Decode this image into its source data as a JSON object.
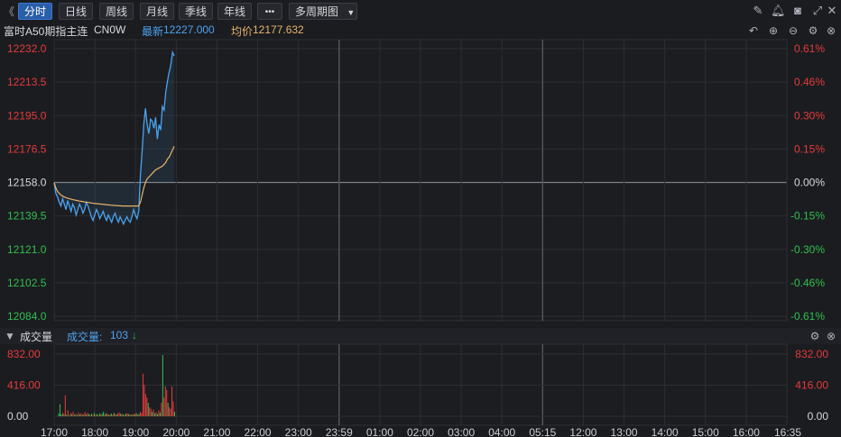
{
  "toolbar": {
    "nav_arrow": "《",
    "tabs": [
      "分时",
      "日线",
      "周线",
      "月线",
      "季线",
      "年线"
    ],
    "more": "•••",
    "multi_period": "多周期图",
    "multi_period_arrow": "▼"
  },
  "info": {
    "instrument": "富时A50期指主连",
    "code": "CN0W",
    "latest_label": "最新",
    "latest_value": "12227.000",
    "avg_label": "均价",
    "avg_value": "12177.632"
  },
  "volume_bar": {
    "label": "成交量",
    "metric_label": "成交量:",
    "metric_value": "103",
    "arrow": "↓"
  },
  "colors": {
    "price_line": "#4aa3f0",
    "avg_line": "#e8b36a",
    "up": "#e33b3b",
    "down": "#2fbf4f",
    "grid": "#2c2e33",
    "background": "#1b1c20"
  },
  "chart_data": [
    {
      "type": "line",
      "title": "",
      "yticks_left": [
        "12232.0",
        "12213.5",
        "12195.0",
        "12176.5",
        "12158.0",
        "12139.5",
        "12121.0",
        "12102.5",
        "12084.0"
      ],
      "yticks_right": [
        "0.61%",
        "0.46%",
        "0.30%",
        "0.15%",
        "0.00%",
        "-0.15%",
        "-0.30%",
        "-0.46%",
        "-0.61%"
      ],
      "ylim": [
        12084.0,
        12232.0
      ],
      "reference": 12158.0,
      "series": [
        {
          "values": [
            12158,
            12152,
            12150,
            12147,
            12145,
            12149,
            12146,
            12143,
            12148,
            12145,
            12142,
            12146,
            12144,
            12140,
            12143,
            12146,
            12144,
            12141,
            12143,
            12147,
            12145,
            12142,
            12139,
            12137,
            12140,
            12143,
            12141,
            12138,
            12140,
            12142,
            12139,
            12137,
            12140,
            12138,
            12136,
            12139,
            12141,
            12138,
            12136,
            12139,
            12137,
            12135,
            12137,
            12139,
            12137,
            12136,
            12139,
            12143,
            12140,
            12138,
            12142,
            12162,
            12175,
            12190,
            12199,
            12190,
            12185,
            12193,
            12192,
            12188,
            12194,
            12182,
            12190,
            12187,
            12200,
            12198,
            12208,
            12214,
            12219,
            12223,
            12230,
            12228
          ],
          "stroke": "#4aa3f0"
        },
        {
          "values": [
            12158,
            12155,
            12153,
            12152,
            12151,
            12150.5,
            12150,
            12149.6,
            12149.3,
            12149,
            12148.8,
            12148.5,
            12148.3,
            12148.1,
            12147.9,
            12147.7,
            12147.6,
            12147.4,
            12147.2,
            12147.1,
            12147,
            12146.8,
            12146.7,
            12146.5,
            12146.4,
            12146.3,
            12146.2,
            12146.1,
            12146,
            12145.9,
            12145.8,
            12145.7,
            12145.6,
            12145.5,
            12145.4,
            12145.3,
            12145.3,
            12145.2,
            12145.1,
            12145.1,
            12145,
            12145,
            12145,
            12145,
            12145,
            12145,
            12145,
            12145,
            12145,
            12145,
            12145,
            12147,
            12151,
            12155,
            12158,
            12160,
            12161,
            12162,
            12163,
            12164,
            12165,
            12165.5,
            12166,
            12166.5,
            12167,
            12168,
            12169,
            12171,
            12172,
            12174,
            12176,
            12178
          ],
          "stroke": "#e8b36a"
        }
      ],
      "x_ticks": [
        "17:00",
        "18:00",
        "19:00",
        "20:00",
        "21:00",
        "22:00",
        "23:00",
        "23:59",
        "01:00",
        "02:00",
        "03:00",
        "04:00",
        "05:15",
        "12:00",
        "13:00",
        "14:00",
        "15:00",
        "16:00",
        "16:35"
      ]
    },
    {
      "type": "bar",
      "title": "",
      "yticks_left": [
        "832.00",
        "416.00",
        "0.00"
      ],
      "yticks_right": [
        "832.00",
        "416.00",
        "0.00"
      ],
      "ylim": [
        0,
        832
      ],
      "values": [
        40,
        160,
        25,
        50,
        30,
        280,
        20,
        80,
        10,
        45,
        30,
        60,
        20,
        35,
        15,
        50,
        25,
        40,
        20,
        30,
        60,
        25,
        45,
        30,
        20,
        35,
        15,
        45,
        20,
        30,
        15,
        40,
        25,
        35,
        60,
        25,
        40,
        30,
        20,
        25,
        35,
        20,
        45,
        30,
        25,
        40,
        50,
        35,
        30,
        25,
        20,
        35,
        40,
        30,
        25,
        20,
        30,
        25,
        35,
        40,
        25,
        30,
        60,
        45,
        570,
        420,
        300,
        250,
        180,
        120,
        100,
        60,
        90,
        40,
        55,
        30,
        80,
        50,
        180,
        820,
        250,
        400,
        350,
        180,
        120,
        100,
        400,
        200,
        60
      ],
      "colors": [
        "d",
        "d",
        "d",
        "u",
        "d",
        "u",
        "d",
        "u",
        "d",
        "u",
        "d",
        "u",
        "d",
        "u",
        "d",
        "u",
        "d",
        "u",
        "d",
        "u",
        "u",
        "d",
        "u",
        "d",
        "u",
        "d",
        "u",
        "d",
        "u",
        "d",
        "u",
        "d",
        "u",
        "d",
        "d",
        "u",
        "d",
        "u",
        "d",
        "u",
        "d",
        "u",
        "d",
        "u",
        "d",
        "u",
        "u",
        "d",
        "u",
        "d",
        "u",
        "d",
        "u",
        "d",
        "u",
        "d",
        "u",
        "d",
        "u",
        "d",
        "u",
        "d",
        "u",
        "u",
        "u",
        "u",
        "u",
        "u",
        "d",
        "u",
        "u",
        "d",
        "u",
        "d",
        "u",
        "d",
        "u",
        "d",
        "u",
        "d",
        "u",
        "u",
        "u",
        "d",
        "u",
        "u",
        "u",
        "u",
        "d"
      ]
    }
  ]
}
